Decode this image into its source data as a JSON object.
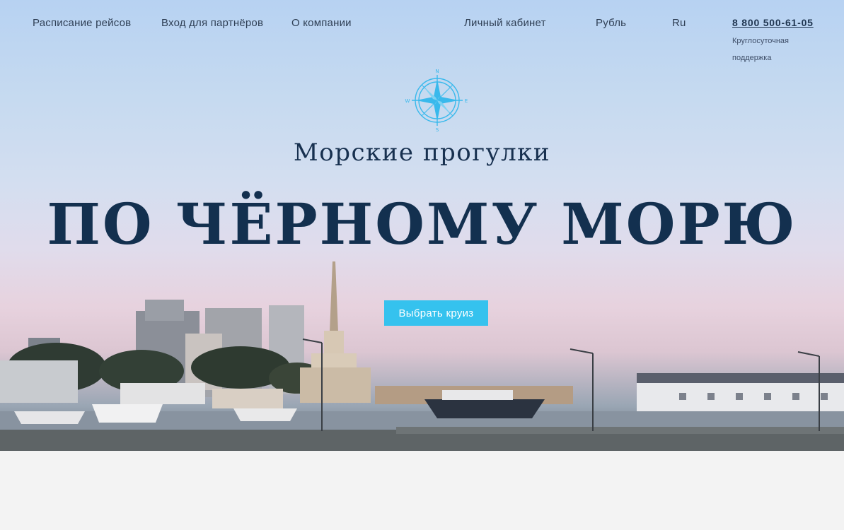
{
  "nav": {
    "schedule": "Расписание рейсов",
    "partners": "Вход для партнёров",
    "about": "О компании",
    "account": "Личный кабинет",
    "currency": "Рубль",
    "language": "Ru"
  },
  "contact": {
    "phone": "8 800 500-61-05",
    "support": "Круглосуточная поддержка"
  },
  "compass": {
    "n": "N",
    "e": "E",
    "s": "S",
    "w": "W",
    "icon": "compass-icon"
  },
  "hero": {
    "subtitle": "Морские прогулки",
    "title": "ПО ЧЁРНОМУ МОРЮ",
    "cta_label": "Выбрать круиз"
  },
  "colors": {
    "accent": "#35c2ee",
    "title": "#13304f",
    "footer_bg": "#f3f3f3"
  }
}
